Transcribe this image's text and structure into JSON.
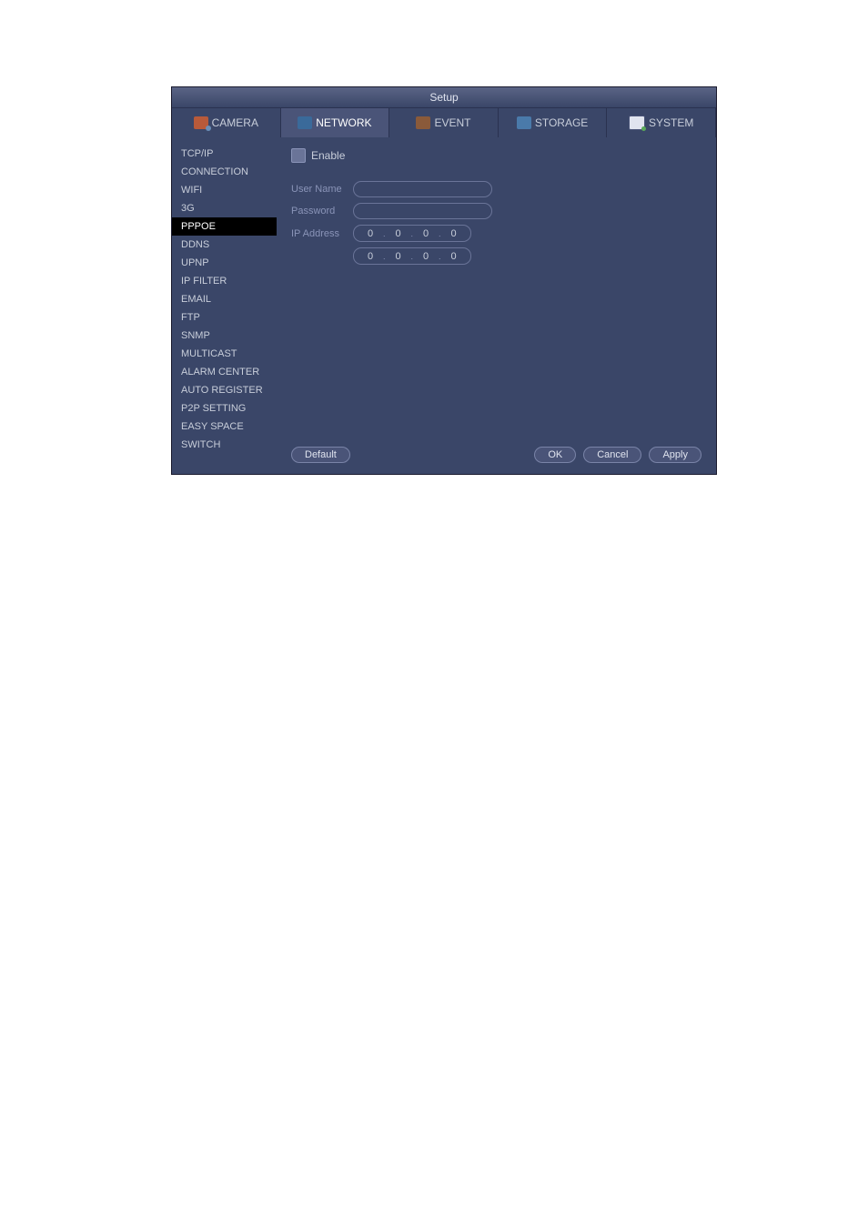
{
  "window": {
    "title": "Setup"
  },
  "tabs": {
    "camera": "CAMERA",
    "network": "NETWORK",
    "event": "EVENT",
    "storage": "STORAGE",
    "system": "SYSTEM"
  },
  "sidebar": {
    "items": [
      "TCP/IP",
      "CONNECTION",
      "WIFI",
      "3G",
      "PPPOE",
      "DDNS",
      "UPNP",
      "IP FILTER",
      "EMAIL",
      "FTP",
      "SNMP",
      "MULTICAST",
      "ALARM CENTER",
      "AUTO REGISTER",
      "P2P SETTING",
      "EASY SPACE",
      "SWITCH"
    ],
    "active_index": 4
  },
  "form": {
    "enable_label": "Enable",
    "username_label": "User Name",
    "username_value": "",
    "password_label": "Password",
    "password_value": "",
    "ipaddress_label": "IP Address",
    "ip1": [
      "0",
      "0",
      "0",
      "0"
    ],
    "ip2": [
      "0",
      "0",
      "0",
      "0"
    ]
  },
  "buttons": {
    "default": "Default",
    "ok": "OK",
    "cancel": "Cancel",
    "apply": "Apply"
  }
}
